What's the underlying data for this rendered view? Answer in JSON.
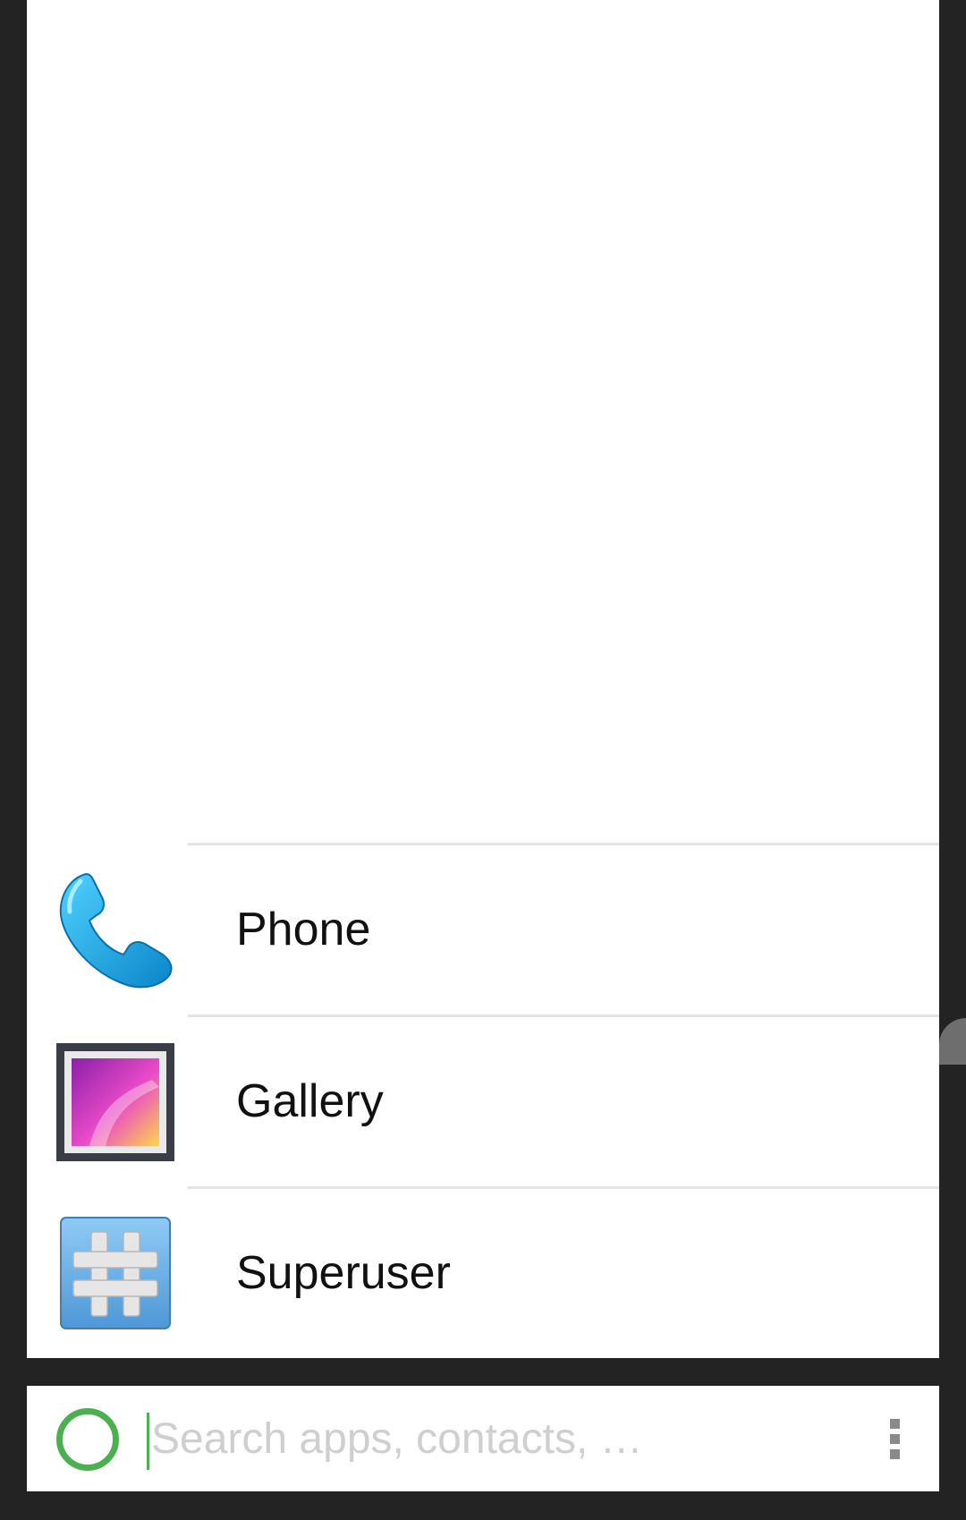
{
  "results": [
    {
      "label": "Phone",
      "icon": "phone-icon"
    },
    {
      "label": "Gallery",
      "icon": "gallery-icon"
    },
    {
      "label": "Superuser",
      "icon": "superuser-icon"
    }
  ],
  "search": {
    "placeholder": "Search apps, contacts, …",
    "value": ""
  },
  "colors": {
    "accent": "#4caf50",
    "background": "#232323",
    "card": "#ffffff"
  }
}
